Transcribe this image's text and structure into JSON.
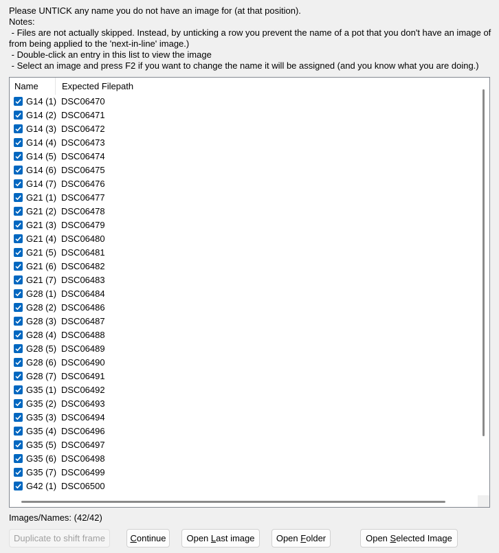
{
  "instructions": {
    "line1": "Please UNTICK any name you do not have an image for (at that position).",
    "line2": "Notes:",
    "line3": " - Files are not actually skipped. Instead, by unticking a row you prevent the name of a pot that you don't have an image of from being applied to the 'next-in-line' image.)",
    "line4": " - Double-click an entry in this list to view the image",
    "line5": " - Select an image and press F2 if you want to change the name it will be assigned (and you know what you are doing.)"
  },
  "list": {
    "columns": {
      "name": "Name",
      "path": "Expected Filepath"
    },
    "rows": [
      {
        "name": "G14 (1)",
        "path": "DSC06470",
        "checked": true
      },
      {
        "name": "G14 (2)",
        "path": "DSC06471",
        "checked": true
      },
      {
        "name": "G14 (3)",
        "path": "DSC06472",
        "checked": true
      },
      {
        "name": "G14 (4)",
        "path": "DSC06473",
        "checked": true
      },
      {
        "name": "G14 (5)",
        "path": "DSC06474",
        "checked": true
      },
      {
        "name": "G14 (6)",
        "path": "DSC06475",
        "checked": true
      },
      {
        "name": "G14 (7)",
        "path": "DSC06476",
        "checked": true
      },
      {
        "name": "G21 (1)",
        "path": "DSC06477",
        "checked": true
      },
      {
        "name": "G21 (2)",
        "path": "DSC06478",
        "checked": true
      },
      {
        "name": "G21 (3)",
        "path": "DSC06479",
        "checked": true
      },
      {
        "name": "G21 (4)",
        "path": "DSC06480",
        "checked": true
      },
      {
        "name": "G21 (5)",
        "path": "DSC06481",
        "checked": true
      },
      {
        "name": "G21 (6)",
        "path": "DSC06482",
        "checked": true
      },
      {
        "name": "G21 (7)",
        "path": "DSC06483",
        "checked": true
      },
      {
        "name": "G28 (1)",
        "path": "DSC06484",
        "checked": true
      },
      {
        "name": "G28 (2)",
        "path": "DSC06486",
        "checked": true
      },
      {
        "name": "G28 (3)",
        "path": "DSC06487",
        "checked": true
      },
      {
        "name": "G28 (4)",
        "path": "DSC06488",
        "checked": true
      },
      {
        "name": "G28 (5)",
        "path": "DSC06489",
        "checked": true
      },
      {
        "name": "G28 (6)",
        "path": "DSC06490",
        "checked": true
      },
      {
        "name": "G28 (7)",
        "path": "DSC06491",
        "checked": true
      },
      {
        "name": "G35 (1)",
        "path": "DSC06492",
        "checked": true
      },
      {
        "name": "G35 (2)",
        "path": "DSC06493",
        "checked": true
      },
      {
        "name": "G35 (3)",
        "path": "DSC06494",
        "checked": true
      },
      {
        "name": "G35 (4)",
        "path": "DSC06496",
        "checked": true
      },
      {
        "name": "G35 (5)",
        "path": "DSC06497",
        "checked": true
      },
      {
        "name": "G35 (6)",
        "path": "DSC06498",
        "checked": true
      },
      {
        "name": "G35 (7)",
        "path": "DSC06499",
        "checked": true
      },
      {
        "name": "G42 (1)",
        "path": "DSC06500",
        "checked": true
      }
    ]
  },
  "status": {
    "label": "Images/Names: (42/42)"
  },
  "buttons": {
    "duplicate": "Duplicate to shift frame",
    "continue_pre": "",
    "continue_key": "C",
    "continue_post": "ontinue",
    "open_last_pre": "Open ",
    "open_last_key": "L",
    "open_last_post": "ast image",
    "open_folder_pre": "Open ",
    "open_folder_key": "F",
    "open_folder_post": "older",
    "open_selected_pre": "Open ",
    "open_selected_key": "S",
    "open_selected_post": "elected Image"
  },
  "colors": {
    "checkbox": "#0067c0",
    "background": "#f0f0f0"
  }
}
